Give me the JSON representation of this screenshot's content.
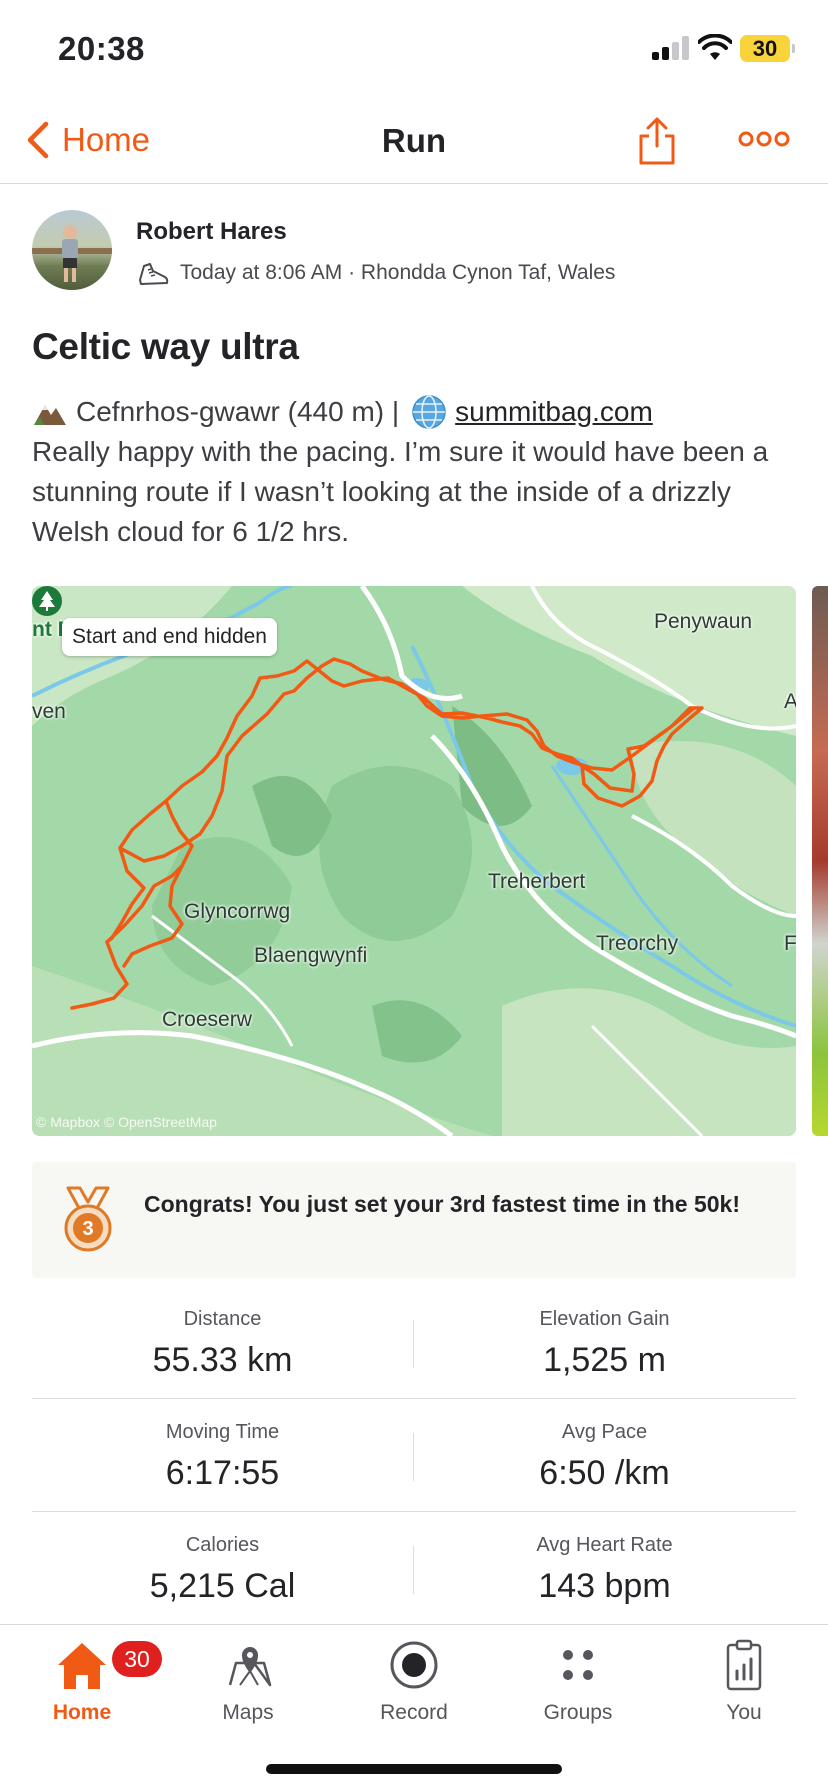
{
  "status_bar": {
    "time": "20:38",
    "battery": "30"
  },
  "nav": {
    "back_label": "Home",
    "title": "Run"
  },
  "athlete": {
    "name": "Robert Hares",
    "meta": "Today at 8:06 AM · Rhondda Cynon Taf, Wales"
  },
  "activity": {
    "title": "Celtic way ultra",
    "summit_text": "Cefnrhos-gwawr (440 m) |",
    "summit_link": "summitbag.com",
    "description": "Really happy with the pacing. I’m sure it would have been a stunning route if I wasn’t looking at the inside of a drizzly Welsh cloud for 6 1/2 hrs."
  },
  "map": {
    "badge": "Start and end hidden",
    "labels": {
      "penywaun": "Penywaun",
      "glyncorrwg": "Glyncorrwg",
      "treherbert": "Treherbert",
      "treorchy": "Treorchy",
      "blaengwynfi": "Blaengwynfi",
      "croeserw": "Croeserw",
      "edge_left_top": "nt F",
      "edge_left_mid": "ven",
      "edge_right_a": "A",
      "edge_right_f": "F"
    },
    "attribution": "© Mapbox © OpenStreetMap",
    "route_color": "#f05a14"
  },
  "achievement": {
    "text": "Congrats! You just set your 3rd fastest time in the 50k!",
    "medal_rank": "3"
  },
  "stats": [
    {
      "left_label": "Distance",
      "left_value": "55.33 km",
      "right_label": "Elevation Gain",
      "right_value": "1,525 m"
    },
    {
      "left_label": "Moving Time",
      "left_value": "6:17:55",
      "right_label": "Avg Pace",
      "right_value": "6:50 /km"
    },
    {
      "left_label": "Calories",
      "left_value": "5,215 Cal",
      "right_label": "Avg Heart Rate",
      "right_value": "143 bpm"
    }
  ],
  "tabs": {
    "home": "Home",
    "home_badge": "30",
    "maps": "Maps",
    "record": "Record",
    "groups": "Groups",
    "you": "You"
  },
  "colors": {
    "accent": "#f05a14",
    "badge": "#e0201e",
    "map_green": "#9fd6a4"
  }
}
